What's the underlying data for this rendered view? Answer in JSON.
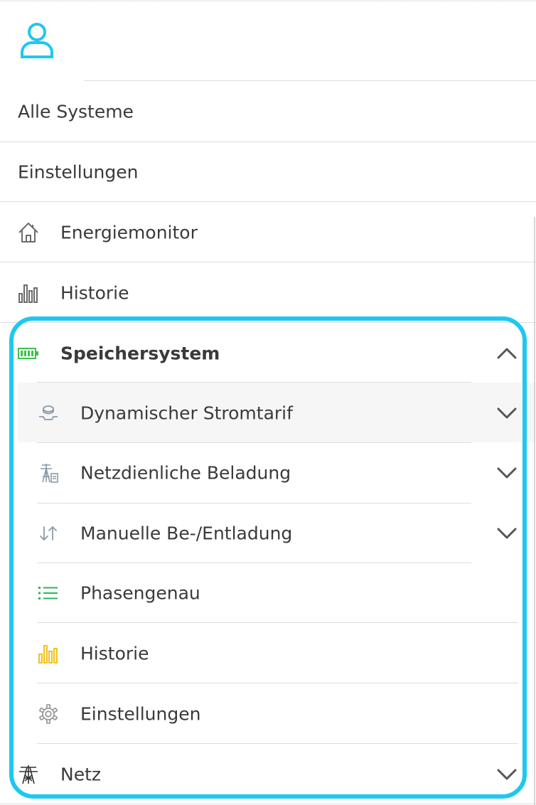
{
  "nav": {
    "all_systems": "Alle Systeme",
    "settings": "Einstellungen",
    "energy_monitor": "Energiemonitor",
    "history": "Historie",
    "storage": {
      "label": "Speichersystem",
      "items": [
        {
          "label": "Dynamischer Stromtarif",
          "icon": "tariff-icon"
        },
        {
          "label": "Netzdienliche Beladung",
          "icon": "grid-charging-icon"
        },
        {
          "label": "Manuelle Be-/Entladung",
          "icon": "up-down-arrows-icon"
        },
        {
          "label": "Phasengenau",
          "icon": "list-icon"
        },
        {
          "label": "Historie",
          "icon": "bar-chart-icon"
        },
        {
          "label": "Einstellungen",
          "icon": "gear-icon"
        }
      ]
    },
    "grid": "Netz"
  },
  "colors": {
    "accent": "#1ec8f0",
    "battery": "#3cc24a",
    "list": "#2fb55a",
    "history": "#f2c21b",
    "muted_icon": "#8a9aa8",
    "text": "#3a3a3a"
  }
}
